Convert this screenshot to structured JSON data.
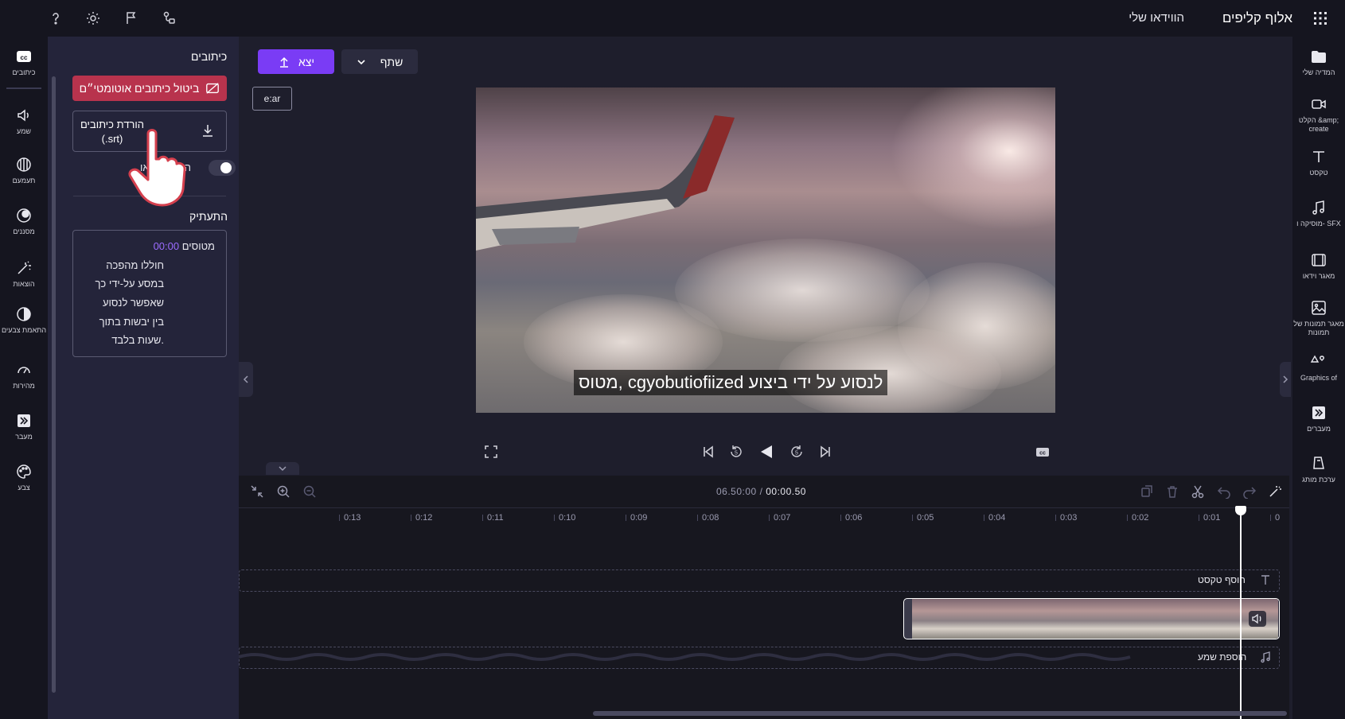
{
  "app": {
    "title": "אלוף קליפים",
    "my_videos": "הווידאו שלי"
  },
  "right_sidebar": {
    "items": [
      {
        "label": "המדיה שלי",
        "icon": "folder-icon"
      },
      {
        "label": "הקלט &amp; create",
        "icon": "record-icon"
      },
      {
        "label": "טקסט",
        "icon": "text-icon"
      },
      {
        "label": "מוסיקה ו- SFX",
        "icon": "music-icon"
      },
      {
        "label": "מאגר וידאו",
        "icon": "film-icon"
      },
      {
        "label": "מאגר תמונות של תמונות",
        "icon": "image-icon"
      },
      {
        "label": "Graphics of",
        "icon": "shapes-icon"
      },
      {
        "label": "מעברים",
        "icon": "transition-icon"
      },
      {
        "label": "ערכת מותג",
        "icon": "brand-kit-icon"
      }
    ]
  },
  "left_sidebar": {
    "items": [
      {
        "label": "כיתובים",
        "icon": "cc-icon"
      },
      {
        "label": "שמע",
        "icon": "audio-icon"
      },
      {
        "label": "תעמעם",
        "icon": "fade-icon"
      },
      {
        "label": "מסננים",
        "icon": "filters-icon"
      },
      {
        "label": "הוצאות",
        "icon": "effects-icon"
      },
      {
        "label": "התאמת צבעים",
        "icon": "color-adjust-icon"
      },
      {
        "label": "מהירות",
        "icon": "speed-icon"
      },
      {
        "label": "מעבר",
        "icon": "transition-icon"
      },
      {
        "label": "צבע",
        "icon": "palette-icon"
      }
    ]
  },
  "captions_panel": {
    "title": "כיתובים",
    "disable_auto_label": "ביטול כיתובים אוטומטי״ם",
    "download_label_line1": "הורדת כיתובים",
    "download_label_line2": "(.srt)",
    "burn_label": "היית בווידאו",
    "burn_enabled": false,
    "transcript_title": "התעתיק",
    "transcript_time": "00:00",
    "transcript_lines": [
      "מטוסים",
      "חוללו מהפכה",
      "במסע על-ידי כך",
      "שאפשר לנסוע",
      "בין יבשות בתוך",
      "שעות בלבד."
    ]
  },
  "preview_toolbar": {
    "export_label": "יצא",
    "share_label": "שתף",
    "aspect_label": "e:ar"
  },
  "preview": {
    "subtitle": "מטוס, cgyobutiofiized לנסוע על ידי ביצוע"
  },
  "timeline": {
    "current_time": "00:00.50",
    "separator": "/",
    "total_time": "06.50:00",
    "ruler_labels": [
      "0",
      "0:01",
      "0:02",
      "0:03",
      "0:04",
      "0:05",
      "0:06",
      "0:07",
      "0:08",
      "0:09",
      "0:10",
      "0:11",
      "0:12",
      "0:13"
    ],
    "add_text_label": "הוסף טקסט",
    "add_audio_label": "הוספת שמע",
    "playhead_seconds": 0.5
  },
  "colors": {
    "accent": "#7a3cf5",
    "danger": "#b8334d",
    "background": "#1e1e2c",
    "sidebar": "#15151f",
    "panel": "#24243a",
    "timeline": "#17171f"
  }
}
